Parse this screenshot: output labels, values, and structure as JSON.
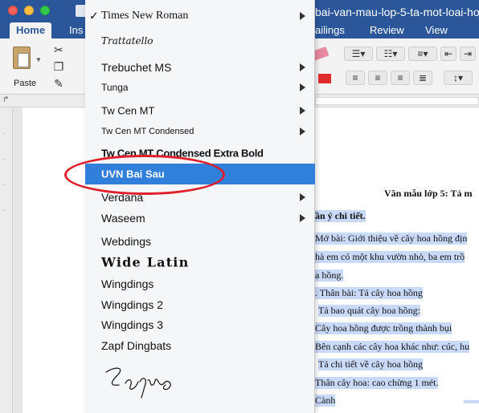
{
  "window": {
    "title": "bai-van-mau-lop-5-ta-mot-loai-ho"
  },
  "ribbon": {
    "tabs": [
      "Home",
      "Ins",
      "ailings",
      "Review",
      "View"
    ],
    "paste_label": "Paste"
  },
  "font_menu": {
    "items": [
      {
        "label": "Times New Roman",
        "checked": true,
        "submenu": true
      },
      {
        "label": "Trattatello",
        "checked": false,
        "submenu": false
      },
      {
        "label": "Trebuchet MS",
        "checked": false,
        "submenu": true
      },
      {
        "label": "Tunga",
        "checked": false,
        "submenu": true
      },
      {
        "label": "Tw Cen MT",
        "checked": false,
        "submenu": true
      },
      {
        "label": "Tw Cen MT Condensed",
        "checked": false,
        "submenu": true
      },
      {
        "label": "Tw Cen MT Condensed Extra Bold",
        "checked": false,
        "submenu": false
      },
      {
        "label": "UVN Bai Sau",
        "checked": false,
        "submenu": false,
        "highlighted": true
      },
      {
        "label": "Verdana",
        "checked": false,
        "submenu": true
      },
      {
        "label": "Waseem",
        "checked": false,
        "submenu": true
      },
      {
        "label": "Webdings",
        "checked": false,
        "submenu": false
      },
      {
        "label": "Wide Latin",
        "checked": false,
        "submenu": false
      },
      {
        "label": "Wingdings",
        "checked": false,
        "submenu": false
      },
      {
        "label": "Wingdings 2",
        "checked": false,
        "submenu": false
      },
      {
        "label": "Wingdings 3",
        "checked": false,
        "submenu": false
      },
      {
        "label": "Zapf Dingbats",
        "checked": false,
        "submenu": false
      },
      {
        "label": "Zapfino",
        "checked": false,
        "submenu": false
      }
    ]
  },
  "document": {
    "lines": [
      "Văn mẫu lớp 5: Tả m",
      "ần ý chi tiết.",
      "Mở bài: Giới thiệu về cây hoa hồng địn",
      "hà em có một khu vườn nhỏ, ba em trồ",
      "a hồng.",
      ". Thân bài: Tả cây hoa hồng",
      "Tả bao quát cây hoa hồng:",
      "Cây hoa hồng được trồng thành bụi",
      "Bên cạnh các cây hoa khác như: cúc, hu",
      "Tả chi tiết về cây hoa hồng",
      "Thân cây hoa: cao chừng 1 mét.",
      "Cành"
    ]
  },
  "colors": {
    "accent": "#2b579a",
    "menu_highlight": "#2f7fdb",
    "annotation": "#e01f2a",
    "text_highlight": "#c9daf8"
  }
}
